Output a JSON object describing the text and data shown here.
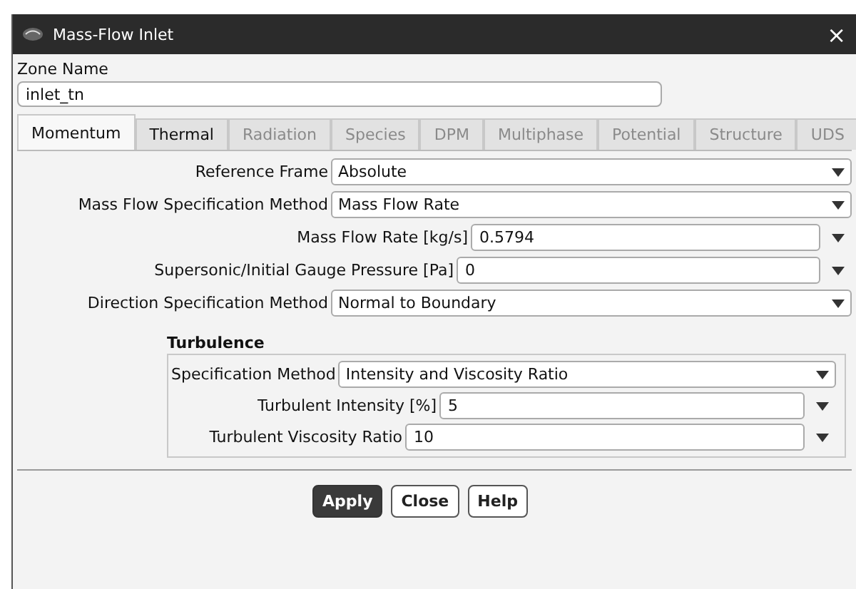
{
  "window": {
    "title": "Mass-Flow Inlet",
    "close": "×"
  },
  "zone": {
    "label": "Zone Name",
    "value": "inlet_tn"
  },
  "tabs": [
    {
      "label": "Momentum",
      "selected": true,
      "disabled": false
    },
    {
      "label": "Thermal",
      "selected": false,
      "disabled": false
    },
    {
      "label": "Radiation",
      "selected": false,
      "disabled": true
    },
    {
      "label": "Species",
      "selected": false,
      "disabled": true
    },
    {
      "label": "DPM",
      "selected": false,
      "disabled": true
    },
    {
      "label": "Multiphase",
      "selected": false,
      "disabled": true
    },
    {
      "label": "Potential",
      "selected": false,
      "disabled": true
    },
    {
      "label": "Structure",
      "selected": false,
      "disabled": true
    },
    {
      "label": "UDS",
      "selected": false,
      "disabled": true
    }
  ],
  "fields": [
    {
      "kind": "dropdown",
      "label": "Reference Frame",
      "value": "Absolute"
    },
    {
      "kind": "dropdown",
      "label": "Mass Flow Specification Method",
      "value": "Mass Flow Rate"
    },
    {
      "kind": "input",
      "label": "Mass Flow Rate [kg/s]",
      "value": "0.5794"
    },
    {
      "kind": "input",
      "label": "Supersonic/Initial Gauge Pressure [Pa]",
      "value": "0"
    },
    {
      "kind": "dropdown",
      "label": "Direction Specification Method",
      "value": "Normal to Boundary"
    }
  ],
  "turbulence": {
    "title": "Turbulence",
    "fields": [
      {
        "kind": "dropdown",
        "label": "Specification Method",
        "value": "Intensity and Viscosity Ratio"
      },
      {
        "kind": "input",
        "label": "Turbulent Intensity [%]",
        "value": "5"
      },
      {
        "kind": "input",
        "label": "Turbulent Viscosity Ratio",
        "value": "10"
      }
    ]
  },
  "buttons": [
    {
      "label": "Apply",
      "kind": "primary"
    },
    {
      "label": "Close",
      "kind": "normal"
    },
    {
      "label": "Help",
      "kind": "normal"
    }
  ]
}
